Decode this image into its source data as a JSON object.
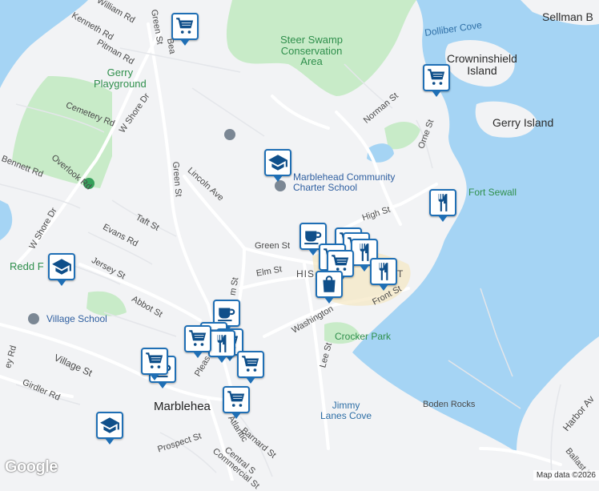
{
  "map": {
    "colors": {
      "water": "#a5d4f4",
      "land": "#f2f3f5",
      "park": "#c8ebc8",
      "road": "#ffffff",
      "marker_border": "#1f6fb5",
      "marker_icon": "#0f4f8a",
      "park_text": "#2f8f4c",
      "poi_text": "#2f5fa0"
    },
    "labels": {
      "water": [
        "Dolliber Cove",
        "Jimmy\nLanes Cove"
      ],
      "islands": [
        "Sellman B",
        "Crowninshield\nIsland",
        "Gerry Island"
      ],
      "parks": [
        "Steer Swamp\nConservation\nArea",
        "Gerry\nPlayground",
        "Fort Sewall",
        "Crocker Park"
      ],
      "pois": [
        "Marblehead Community\nCharter School",
        "Village School",
        "Redd F",
        "Boden Rocks"
      ],
      "towns": [
        "Marblehea",
        "HIS",
        "T"
      ],
      "streets": [
        "William Rd",
        "Kenneth Rd",
        "Pitman Rd",
        "Green St",
        "Bea",
        "Cemetery Rd",
        "W Shore Dr",
        "Bennett Rd",
        "Overlook Rd",
        "Green St",
        "Lincoln Ave",
        "Taft St",
        "Evans Rd",
        "Jersey St",
        "W Shore Dr",
        "Green St",
        "High St",
        "Elm St",
        "Norman St",
        "Orne St",
        "Abbot St",
        "Washington",
        "Front St",
        "Lee St",
        "Pleas",
        "m St",
        "Village St",
        "Girdler Rd",
        "ey Rd",
        "Prospect St",
        "Barnard St",
        "Central S",
        "Commercial St",
        "Atlantic",
        "Harbor Av",
        "Ballast L"
      ]
    },
    "markers": [
      {
        "icon": "shopping-cart-icon"
      },
      {
        "icon": "shopping-cart-icon"
      },
      {
        "icon": "school-icon"
      },
      {
        "icon": "restaurant-icon"
      },
      {
        "icon": "school-icon"
      },
      {
        "icon": "coffee-icon"
      },
      {
        "icon": "shopping-cart-icon"
      },
      {
        "icon": "shopping-cart-icon"
      },
      {
        "icon": "restaurant-icon"
      },
      {
        "icon": "shopping-cart-icon"
      },
      {
        "icon": "shopping-cart-icon"
      },
      {
        "icon": "restaurant-icon"
      },
      {
        "icon": "shopping-bag-icon"
      },
      {
        "icon": "coffee-icon"
      },
      {
        "icon": "shopping-cart-icon"
      },
      {
        "icon": "shopping-cart-icon"
      },
      {
        "icon": "restaurant-icon"
      },
      {
        "icon": "shopping-cart-icon"
      },
      {
        "icon": "coffee-icon"
      },
      {
        "icon": "shopping-cart-icon"
      },
      {
        "icon": "shopping-cart-icon"
      },
      {
        "icon": "shopping-cart-icon"
      },
      {
        "icon": "school-icon"
      }
    ],
    "branding": "Google",
    "attribution": "Map data ©2026"
  }
}
